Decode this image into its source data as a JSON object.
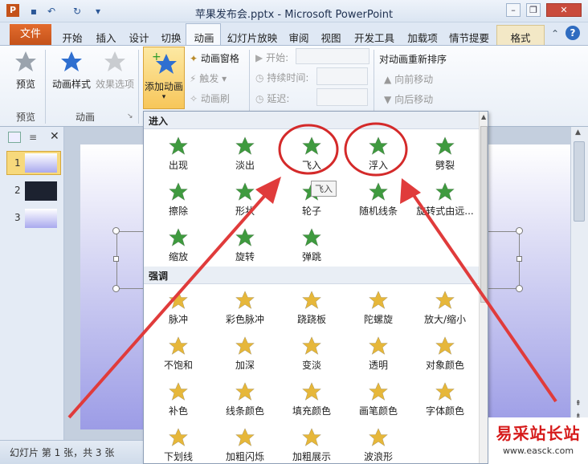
{
  "window": {
    "title": "苹果发布会.pptx - Microsoft PowerPoint"
  },
  "tabs": {
    "file": "文件",
    "items": [
      "开始",
      "插入",
      "设计",
      "切换",
      "动画",
      "幻灯片放映",
      "审阅",
      "视图",
      "开发工具",
      "加载项",
      "情节提要"
    ],
    "format": "格式"
  },
  "ribbon": {
    "preview": "预览",
    "anim_styles": "动画样式",
    "effect_options": "效果选项",
    "add_animation": "添加动画",
    "anim_pane": "动画窗格",
    "trigger": "触发",
    "anim_painter": "动画刷",
    "start": "开始:",
    "duration": "持续时间:",
    "delay": "延迟:",
    "reorder": "对动画重新排序",
    "move_earlier": "向前移动",
    "move_later": "向后移动",
    "group_preview": "预览",
    "group_animation": "动画"
  },
  "slides": [
    "1",
    "2",
    "3"
  ],
  "panel": {
    "entrance_header": "进入",
    "entrance": [
      "出现",
      "淡出",
      "飞入",
      "浮入",
      "劈裂",
      "擦除",
      "形状",
      "轮子",
      "随机线条",
      "旋转式由远...",
      "缩放",
      "旋转",
      "弹跳"
    ],
    "tooltip": "飞入",
    "emphasis_header": "强调",
    "emphasis": [
      "脉冲",
      "彩色脉冲",
      "跷跷板",
      "陀螺旋",
      "放大/缩小",
      "不饱和",
      "加深",
      "变淡",
      "透明",
      "对象颜色",
      "补色",
      "线条颜色",
      "填充颜色",
      "画笔颜色",
      "字体颜色",
      "下划线",
      "加粗闪烁",
      "加粗展示",
      "波浪形"
    ]
  },
  "status": {
    "slide_info": "幻灯片 第 1 张，共 3 张"
  },
  "watermark": {
    "line1": "易采站长站",
    "line2": "www.easck.com"
  },
  "colors": {
    "accent": "#c4521a",
    "highlight_circle": "#d42a2a",
    "arrow": "#e03b3b",
    "entrance_star": "#3f9a3f",
    "emphasis_star": "#e6b73a"
  }
}
